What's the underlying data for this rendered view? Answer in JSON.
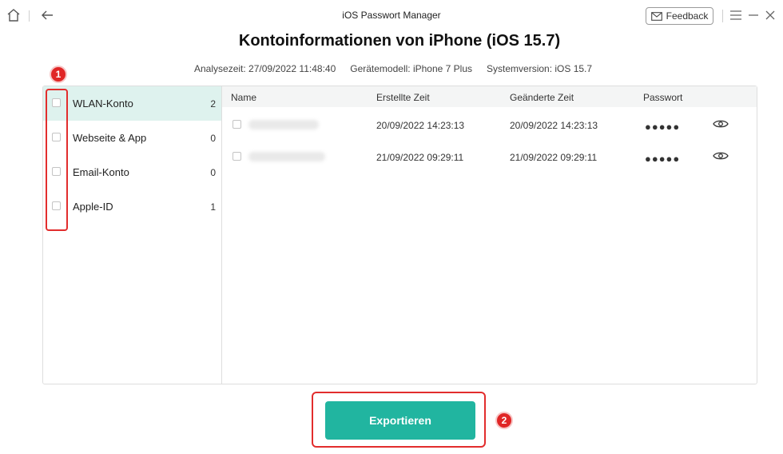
{
  "titlebar": {
    "app_title": "iOS Passwort Manager",
    "feedback_label": "Feedback"
  },
  "header": {
    "title": "Kontoinformationen von iPhone (iOS 15.7)",
    "analysis_time": "Analysezeit: 27/09/2022 11:48:40",
    "device_model": "Gerätemodell: iPhone 7 Plus",
    "system_version": "Systemversion: iOS 15.7"
  },
  "sidebar": {
    "items": [
      {
        "label": "WLAN-Konto",
        "count": "2"
      },
      {
        "label": "Webseite & App",
        "count": "0"
      },
      {
        "label": "Email-Konto",
        "count": "0"
      },
      {
        "label": "Apple-ID",
        "count": "1"
      }
    ]
  },
  "table": {
    "columns": [
      "Name",
      "Erstellte Zeit",
      "Geänderte Zeit",
      "Passwort"
    ],
    "rows": [
      {
        "created": "20/09/2022 14:23:13",
        "modified": "20/09/2022 14:23:13",
        "password": "●●●●●"
      },
      {
        "created": "21/09/2022 09:29:11",
        "modified": "21/09/2022 09:29:11",
        "password": "●●●●●"
      }
    ]
  },
  "annotations": {
    "badge1": "1",
    "badge2": "2"
  },
  "export_label": "Exportieren",
  "colors": {
    "accent": "#21b5a0",
    "active_row": "#def2ee",
    "annotation": "#e22d2d"
  }
}
